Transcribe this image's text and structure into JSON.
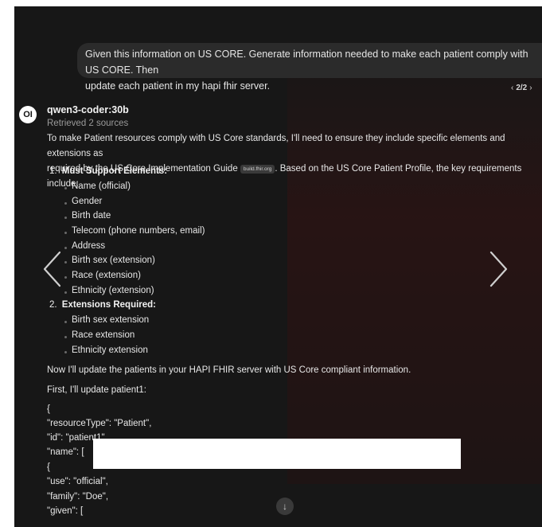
{
  "user_message": {
    "line1": "Given this information on US CORE. Generate information needed to make each patient comply with US CORE. Then",
    "line2": "update each patient in my hapi fhir server."
  },
  "pager": {
    "prev": "‹",
    "current": "2/2",
    "next": "›"
  },
  "assistant": {
    "avatar": "OI",
    "model": "qwen3-coder:30b",
    "sources": "Retrieved 2 sources",
    "intro_1": "To make Patient resources comply with US Core standards, I'll need to ensure they include specific elements and extensions as",
    "intro_2a": "required by the US Core Implementation Guide",
    "citation": "build.fhir.org",
    "intro_2b": ". Based on the US Core Patient Profile, the key requirements include:",
    "list": [
      {
        "number": "1.",
        "title": "Must Support Elements:",
        "items": [
          "Name (official)",
          "Gender",
          "Birth date",
          "Telecom (phone numbers, email)",
          "Address",
          "Birth sex (extension)",
          "Race (extension)",
          "Ethnicity (extension)"
        ]
      },
      {
        "number": "2.",
        "title": "Extensions Required:",
        "items": [
          "Birth sex extension",
          "Race extension",
          "Ethnicity extension"
        ]
      }
    ],
    "para_1": "Now I'll update the patients in your HAPI FHIR server with US Core compliant information.",
    "para_2": "First, I'll update patient1:",
    "code_lines": [
      "{",
      "\"resourceType\": \"Patient\",",
      "\"id\": \"patient1\",",
      "\"name\": [",
      "{",
      "\"use\": \"official\",",
      "\"family\": \"Doe\",",
      "\"given\": ["
    ]
  },
  "icons": {
    "prev_arrow": "chevron-left-icon",
    "next_arrow": "chevron-right-icon",
    "scroll_down": "arrow-down-icon"
  },
  "colors": {
    "background": "#171717",
    "bubble": "#2b2b2b",
    "text": "#e8e8e8",
    "muted": "#9a9a9a"
  }
}
